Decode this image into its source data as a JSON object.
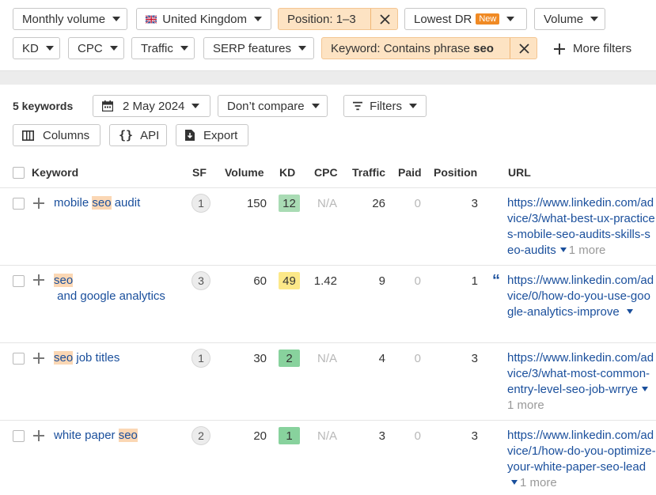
{
  "filters": {
    "monthly_volume": "Monthly volume",
    "country": "United Kingdom",
    "position": "Position: 1–3",
    "lowest_dr": "Lowest DR",
    "new_badge": "New",
    "volume": "Volume",
    "kd": "KD",
    "cpc": "CPC",
    "traffic": "Traffic",
    "serp_features": "SERP features",
    "keyword_prefix": "Keyword: Contains phrase ",
    "keyword_value": "seo",
    "more_filters": "More filters"
  },
  "toolbar": {
    "count": "5 keywords",
    "date": "2 May 2024",
    "compare": "Don’t compare",
    "filters": "Filters",
    "columns": "Columns",
    "api": "API",
    "export": "Export"
  },
  "table": {
    "headers": {
      "keyword": "Keyword",
      "sf": "SF",
      "volume": "Volume",
      "kd": "KD",
      "cpc": "CPC",
      "traffic": "Traffic",
      "paid": "Paid",
      "position": "Position",
      "url": "URL"
    },
    "rows": [
      {
        "kw_before": "mobile ",
        "kw_hl": "seo",
        "kw_after": " audit",
        "sf": "1",
        "volume": "150",
        "kd": "12",
        "kd_color": "#a9dbb4",
        "cpc": "N/A",
        "traffic": "26",
        "paid": "0",
        "position": "3",
        "url": "https://www.linkedin.com/advice/3/what-best-ux-practices-mobile-seo-audits-skills-seo-audits",
        "more": "1 more"
      },
      {
        "kw_before": "",
        "kw_hl": "seo",
        "kw_after": " and google analytics",
        "sf": "3",
        "volume": "60",
        "kd": "49",
        "kd_color": "#fce889",
        "cpc": "1.42",
        "traffic": "9",
        "paid": "0",
        "position": "1",
        "url": "https://www.linkedin.com/advice/0/how-do-you-use-google-analytics-improve",
        "more": ""
      },
      {
        "kw_before": "",
        "kw_hl": "seo",
        "kw_after": " job titles",
        "sf": "1",
        "volume": "30",
        "kd": "2",
        "kd_color": "#88d29d",
        "cpc": "N/A",
        "traffic": "4",
        "paid": "0",
        "position": "3",
        "url": "https://www.linkedin.com/advice/3/what-most-common-entry-level-seo-job-wrrye",
        "more": "1 more"
      },
      {
        "kw_before": "white paper ",
        "kw_hl": "seo",
        "kw_after": "",
        "sf": "2",
        "volume": "20",
        "kd": "1",
        "kd_color": "#88d29d",
        "cpc": "N/A",
        "traffic": "3",
        "paid": "0",
        "position": "3",
        "url": "https://www.linkedin.com/advice/1/how-do-you-optimize-your-white-paper-seo-lead",
        "more": "1 more"
      }
    ]
  }
}
